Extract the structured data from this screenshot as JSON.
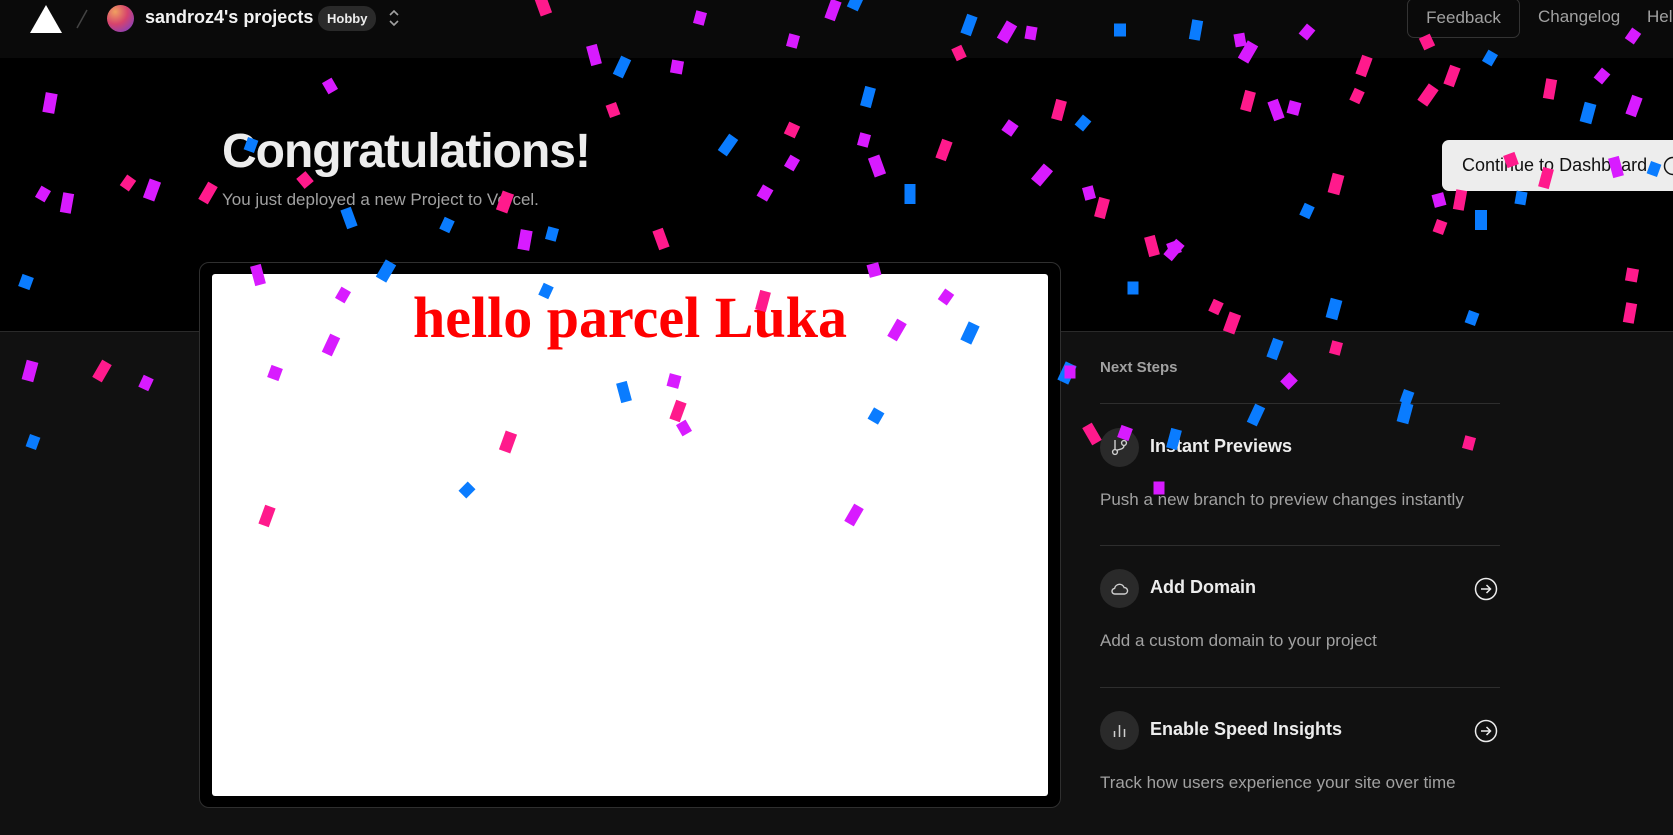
{
  "nav": {
    "project_name": "sandroz4's projects",
    "plan_badge": "Hobby",
    "feedback": "Feedback",
    "changelog": "Changelog",
    "help": "Help"
  },
  "hero": {
    "title": "Congratulations!",
    "subtitle": "You just deployed a new Project to Vercel.",
    "cta": "Continue to Dashboard"
  },
  "preview": {
    "heading": "hello parcel Luka"
  },
  "next_steps": {
    "title": "Next Steps",
    "items": [
      {
        "title": "Instant Previews",
        "description": "Push a new branch to preview changes instantly",
        "icon": "branch-icon"
      },
      {
        "title": "Add Domain",
        "description": "Add a custom domain to your project",
        "icon": "cloud-icon"
      },
      {
        "title": "Enable Speed Insights",
        "description": "Track how users experience your site over time",
        "icon": "bar-chart-icon"
      }
    ]
  },
  "colors": {
    "confetti": [
      "#ff1a8c",
      "#d81bff",
      "#0a7cff"
    ],
    "preview_heading": "#ff0000",
    "cta_bg": "#ededed"
  }
}
